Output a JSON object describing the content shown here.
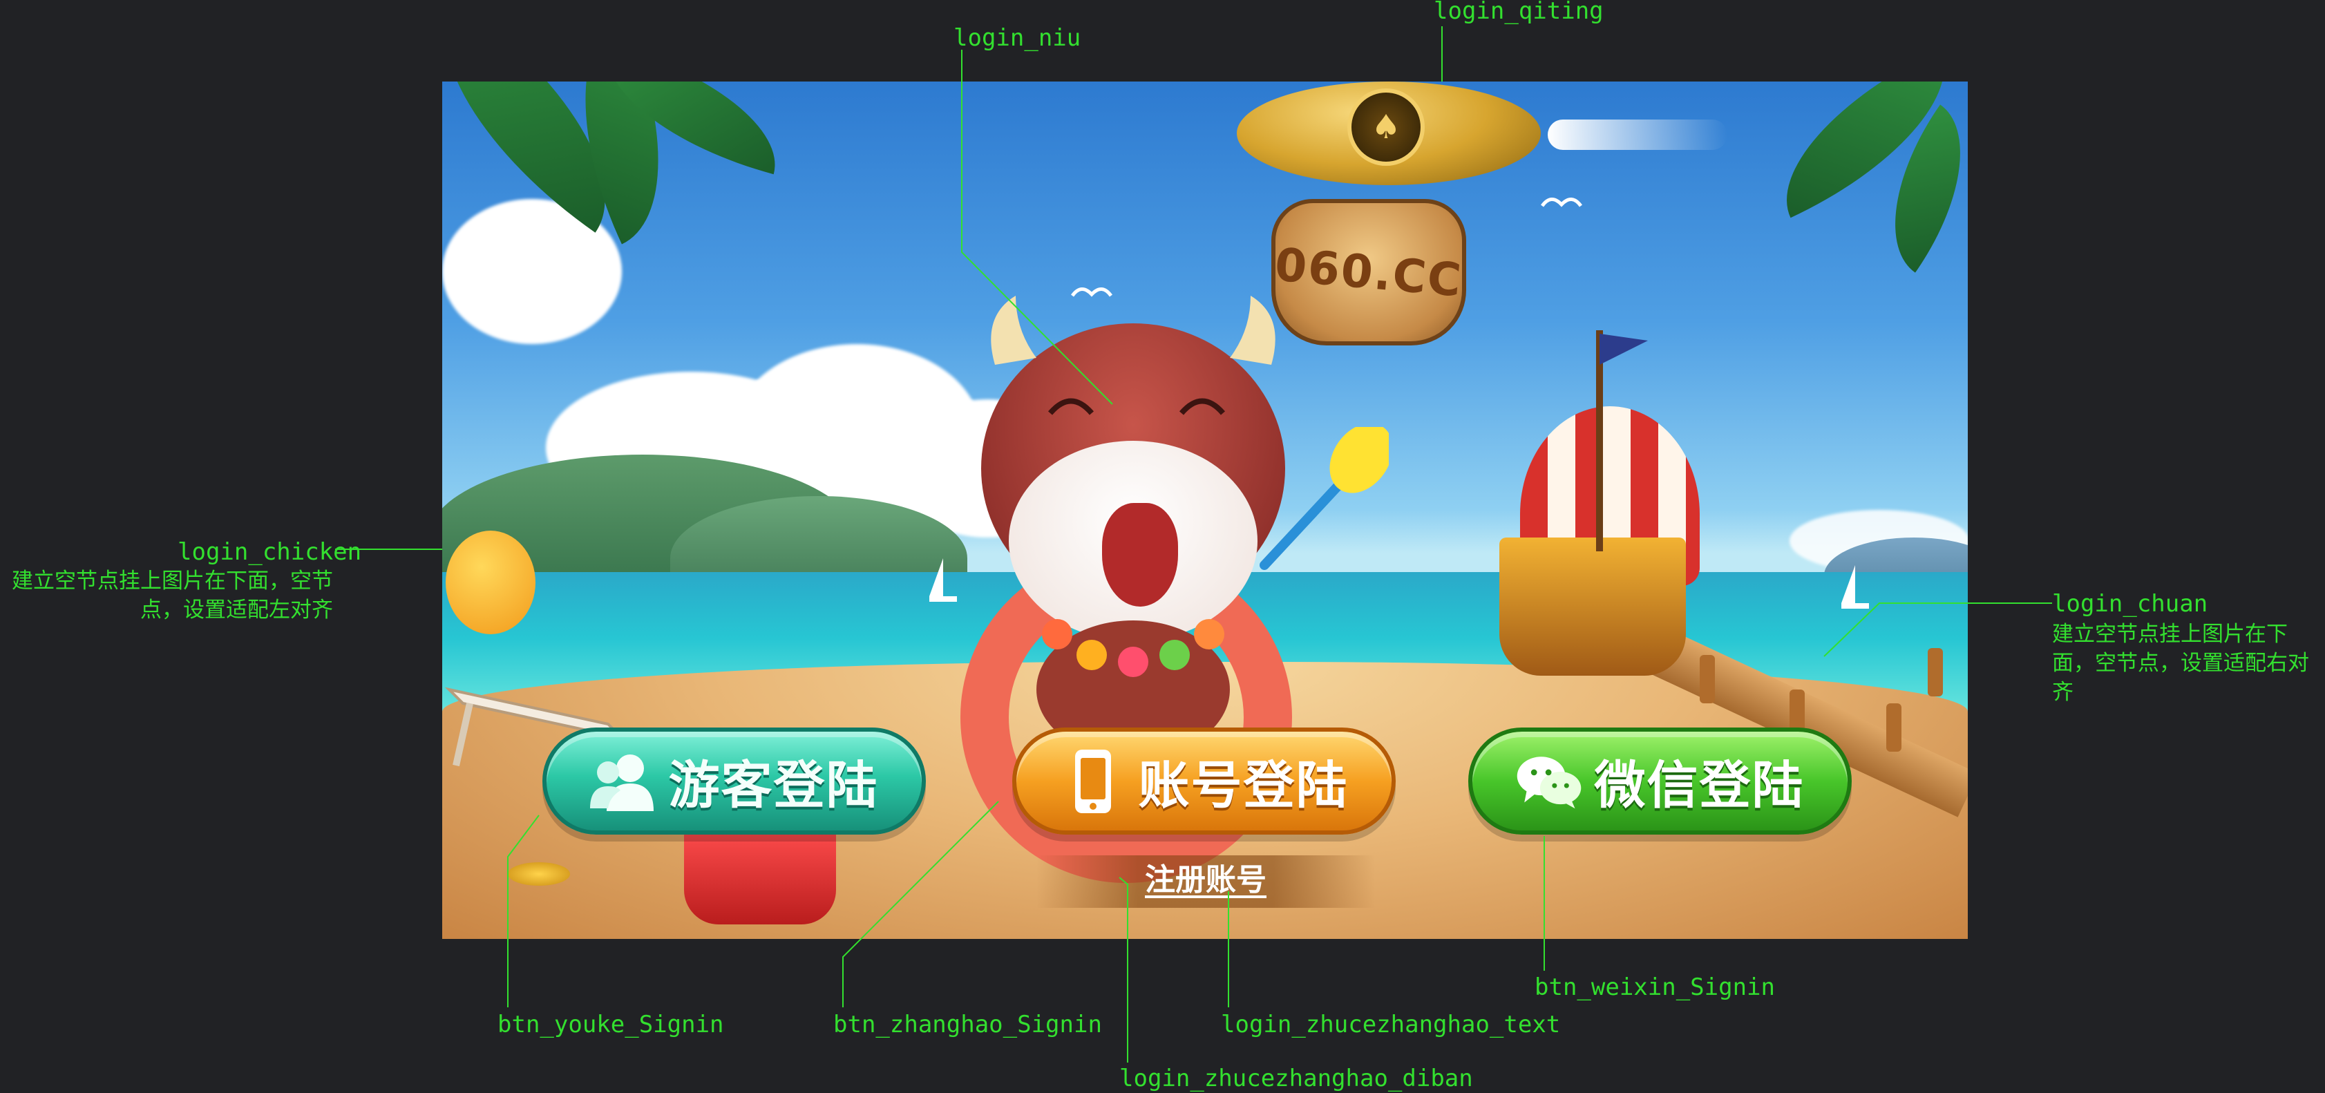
{
  "scene": {
    "sign_text": "060.CC"
  },
  "buttons": {
    "youke": {
      "label": "游客登陆",
      "icon": "people-icon"
    },
    "zhanghao": {
      "label": "账号登陆",
      "icon": "phone-icon"
    },
    "weixin": {
      "label": "微信登陆",
      "icon": "wechat-icon"
    }
  },
  "register": {
    "label": "注册账号"
  },
  "annotations": {
    "login_niu": "login_niu",
    "login_qiting": "login_qiting",
    "login_chicken": "login_chicken",
    "login_chicken_desc": "建立空节点挂上图片在下面，空节点，设置适配左对齐",
    "login_chuan": "login_chuan",
    "login_chuan_desc": "建立空节点挂上图片在下面，空节点，设置适配右对齐",
    "btn_youke_Signin": "btn_youke_Signin",
    "btn_zhanghao_Signin": "btn_zhanghao_Signin",
    "login_zhucezhanghao_text": "login_zhucezhanghao_text",
    "btn_weixin_Signin": "btn_weixin_Signin",
    "login_zhucezhanghao_diban": "login_zhucezhanghao_diban"
  },
  "colors": {
    "background": "#212225",
    "annotation": "#33e02f",
    "youke_button": "#2cc8a6",
    "zhanghao_button": "#f6a021",
    "weixin_button": "#48c62a"
  }
}
